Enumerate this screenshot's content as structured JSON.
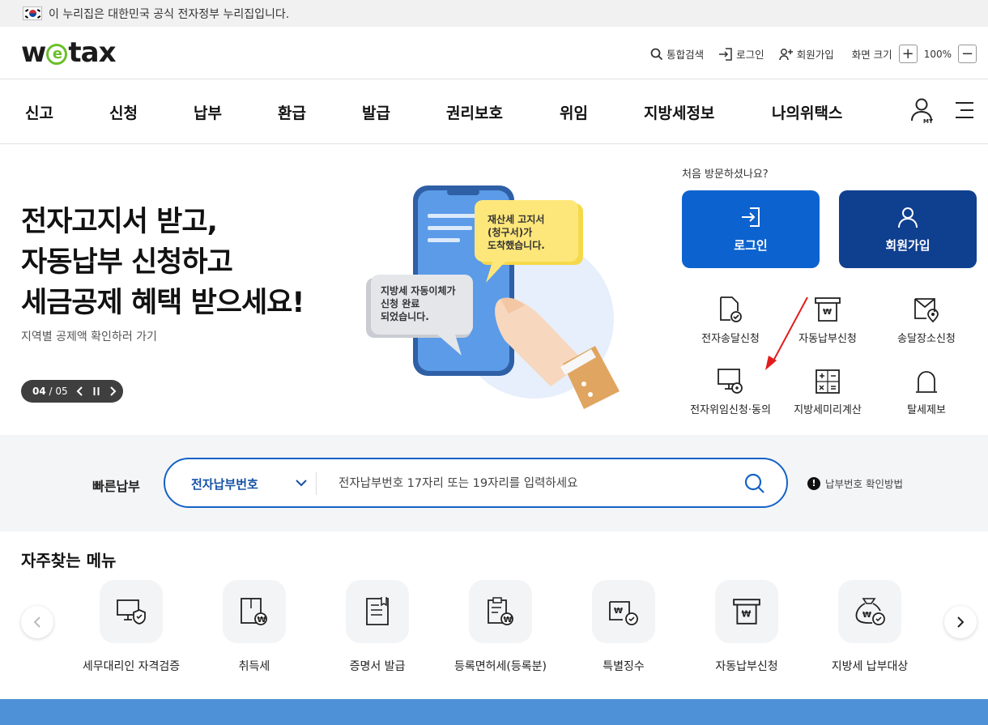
{
  "gov_banner": {
    "text": "이 누리집은 대한민국 공식 전자정부 누리집입니다."
  },
  "header": {
    "logo_left": "w",
    "logo_e": "e",
    "logo_right": "tax",
    "util": {
      "search": "통합검색",
      "login": "로그인",
      "signup": "회원가입",
      "zoom_label": "화면 크기",
      "zoom_in": "+",
      "zoom_value": "100%",
      "zoom_out": "−"
    },
    "my_label": "MY"
  },
  "nav": {
    "items": [
      "신고",
      "신청",
      "납부",
      "환급",
      "발급",
      "권리보호",
      "위임",
      "지방세정보",
      "나의위택스"
    ]
  },
  "hero": {
    "title_line1": "전자고지서 받고,",
    "title_line2": "자동납부 신청하고",
    "title_line3": "세금공제 혜택 받으세요!",
    "subtitle": "지역별 공제액 확인하러 가기",
    "slide_current": "04",
    "slide_total": "/ 05",
    "bubble1_l1": "재산세 고지서",
    "bubble1_l2": "(청구서)가",
    "bubble1_l3": "도착했습니다.",
    "bubble2_l1": "지방세 자동이체가",
    "bubble2_l2": "신청 완료",
    "bubble2_l3": "되었습니다."
  },
  "visit": {
    "question": "처음 방문하셨나요?",
    "login": "로그인",
    "join": "회원가입",
    "services": [
      "전자송달신청",
      "자동납부신청",
      "송달장소신청",
      "전자위임신청·동의",
      "지방세미리계산",
      "탈세제보"
    ]
  },
  "quickpay": {
    "label": "빠른납부",
    "select_value": "전자납부번호",
    "placeholder": "전자납부번호 17자리 또는 19자리를 입력하세요",
    "help": "납부번호 확인방법"
  },
  "frequent": {
    "title": "자주찾는 메뉴",
    "items": [
      "세무대리인 자격검증",
      "취득세",
      "증명서 발급",
      "등록면허세(등록분)",
      "특별징수",
      "자동납부신청",
      "지방세 납부대상"
    ]
  },
  "colors": {
    "primary": "#0c63cf",
    "navy": "#0f3f8f",
    "green": "#6bbf2a",
    "band": "#4f91d6"
  }
}
